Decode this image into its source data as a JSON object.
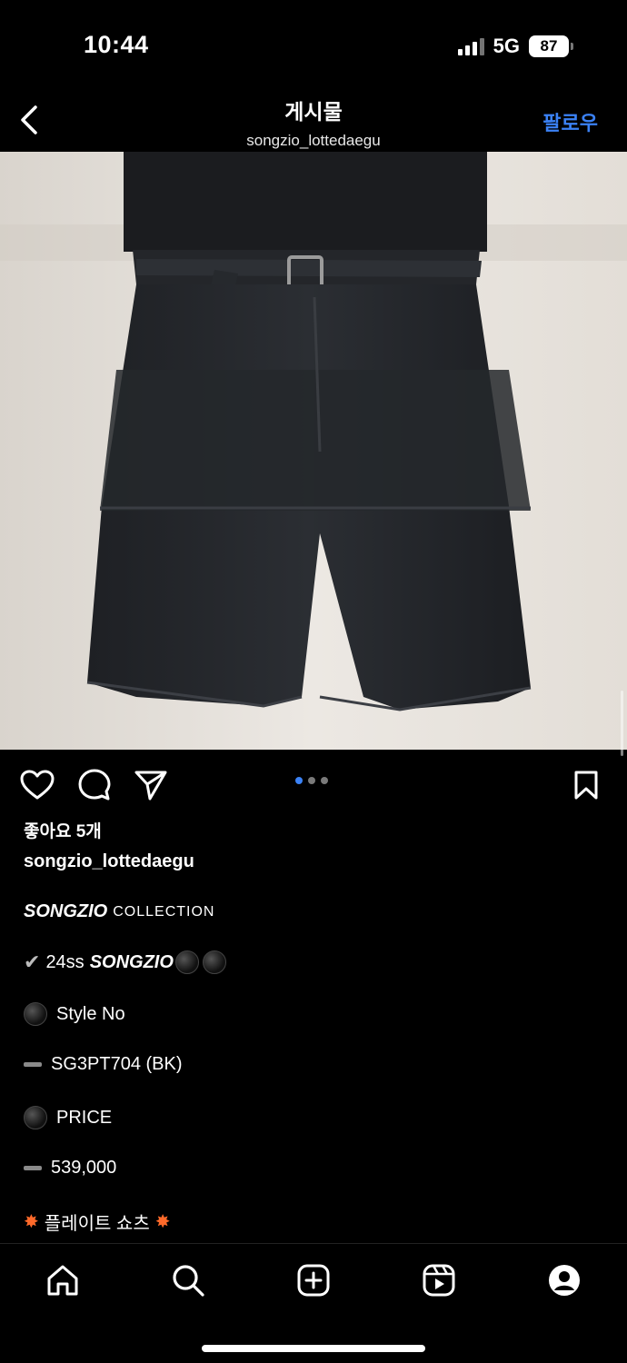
{
  "status_bar": {
    "time": "10:44",
    "network": "5G",
    "battery": "87"
  },
  "header": {
    "title": "게시물",
    "username": "songzio_lottedaegu",
    "follow_label": "팔로우"
  },
  "carousel": {
    "count": 3,
    "active_index": 0
  },
  "post": {
    "likes": "좋아요 5개",
    "author": "songzio_lottedaegu",
    "caption": {
      "brand": "SONGZIO",
      "collection": "COLLECTION",
      "season": "24ss",
      "season_brand": "SONGZIO",
      "style_label": "Style No",
      "style_value": "SG3PT704 (BK)",
      "price_label": "PRICE",
      "price_value": "539,000",
      "product_name": "플레이트 쇼츠"
    }
  },
  "icons": {
    "back": "chevron-left-icon",
    "like": "heart-icon",
    "comment": "comment-icon",
    "share": "send-icon",
    "save": "bookmark-icon",
    "nav": [
      "home-icon",
      "search-icon",
      "create-icon",
      "reels-icon",
      "profile-icon"
    ]
  },
  "colors": {
    "accent": "#3b82f6",
    "background": "#000000"
  }
}
